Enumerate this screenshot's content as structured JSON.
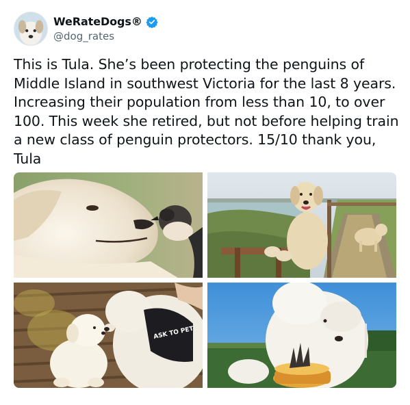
{
  "account": {
    "display_name": "WeRateDogs",
    "registered_mark": "®",
    "handle": "@dog_rates",
    "verified": true,
    "avatar_icon": "dog-avatar-icon",
    "verified_color": "#1d9bf0"
  },
  "tweet": {
    "text": "This is Tula. She’s been protecting the penguins of Middle Island in southwest Victoria for the last 8 years. Increasing their population from less than 10, to over 100. This week she retired, but not before helping train a new class of penguin protectors. 15/10 thank you, Tula"
  },
  "media": {
    "photos": [
      {
        "name": "dog-with-penguin-photo"
      },
      {
        "name": "dog-on-boardwalk-photo"
      },
      {
        "name": "dogs-nose-to-nose-photo",
        "vest_text": "ASK TO PET"
      },
      {
        "name": "dog-with-cake-photo"
      }
    ]
  }
}
